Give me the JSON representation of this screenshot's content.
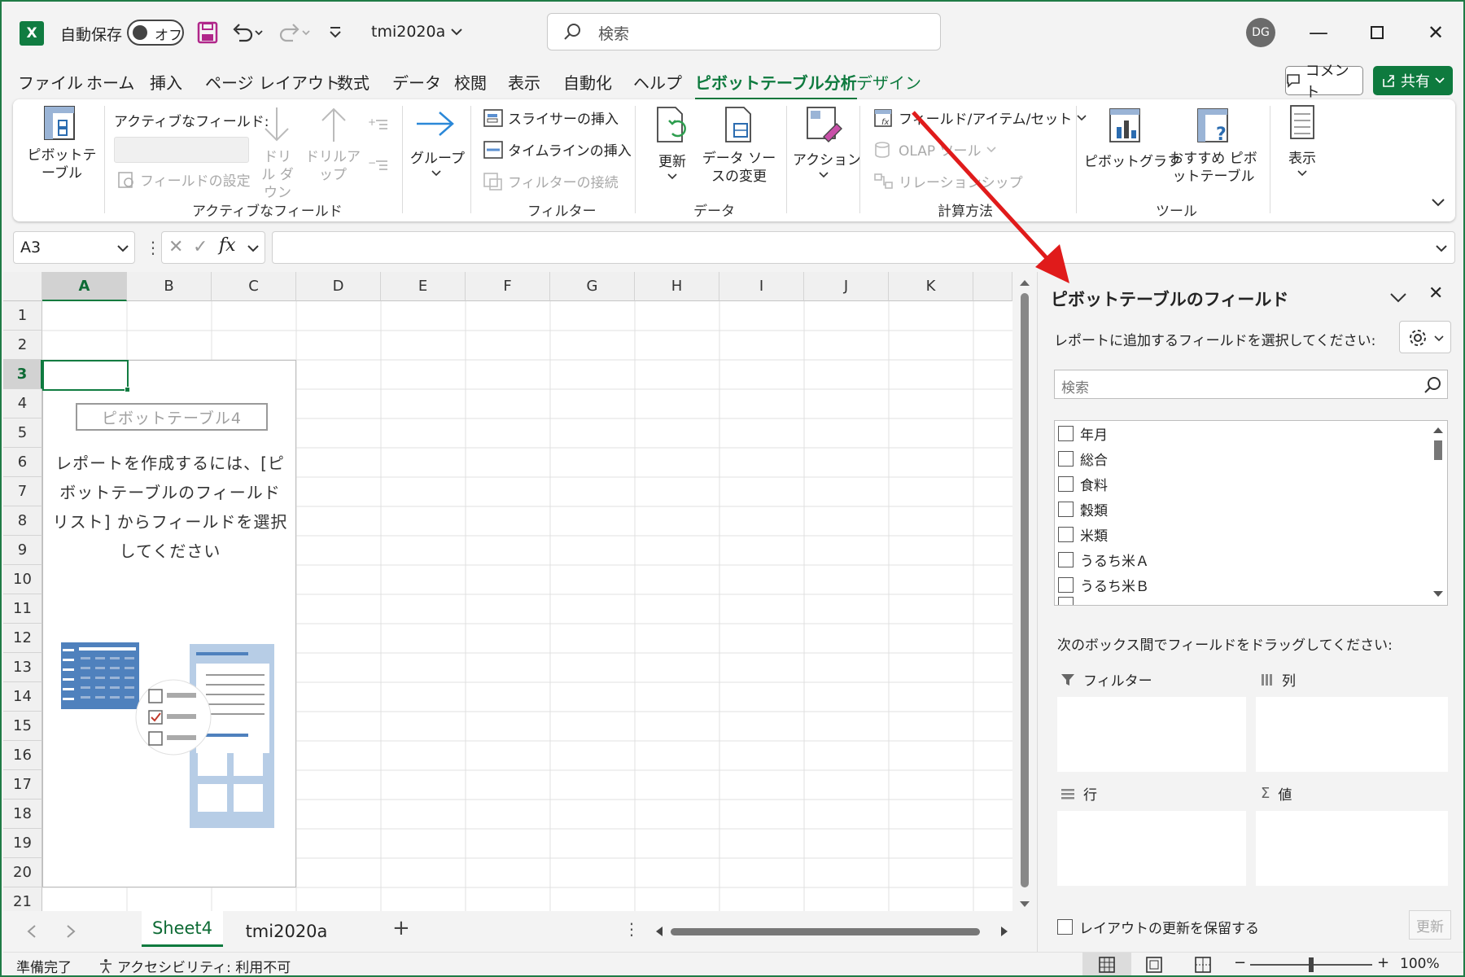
{
  "app": {
    "title": "tmi2020a",
    "autosave_label": "自動保存",
    "autosave_state": "オフ",
    "search_placeholder": "検索",
    "user_initials": "DG",
    "brand_color": "#107c41"
  },
  "menu": {
    "items": [
      "ファイル",
      "ホーム",
      "挿入",
      "ページ レイアウト",
      "数式",
      "データ",
      "校閲",
      "表示",
      "自動化",
      "ヘルプ",
      "ピボットテーブル分析",
      "デザイン"
    ],
    "active": "ピボットテーブル分析",
    "comment_label": "コメント",
    "share_label": "共有"
  },
  "ribbon": {
    "pivot_table_label": "ピボットテーブル",
    "active_field_label": "アクティブなフィールド:",
    "field_settings": "フィールドの設定",
    "drill_down": "ドリル ダウン",
    "drill_up": "ドリルアップ",
    "group_active_field": "アクティブなフィールド",
    "group_label": "グループ",
    "insert_slicer": "スライサーの挿入",
    "insert_timeline": "タイムラインの挿入",
    "filter_connections": "フィルターの接続",
    "group_filter": "フィルター",
    "refresh": "更新",
    "change_source": "データ ソースの変更",
    "group_data": "データ",
    "actions": "アクション",
    "fields_items_sets": "フィールド/アイテム/セット",
    "olap_tools": "OLAP ツール",
    "relationships": "リレーションシップ",
    "group_calc": "計算方法",
    "pivot_chart": "ピボットグラフ",
    "recommended_pivot": "おすすめ ピボットテーブル",
    "group_tools": "ツール",
    "show": "表示"
  },
  "formula_bar": {
    "name_box": "A3",
    "fx": "fx",
    "formula": ""
  },
  "grid": {
    "columns": [
      "A",
      "B",
      "C",
      "D",
      "E",
      "F",
      "G",
      "H",
      "I",
      "J",
      "K"
    ],
    "rows": [
      "1",
      "2",
      "3",
      "4",
      "5",
      "6",
      "7",
      "8",
      "9",
      "10",
      "11",
      "12",
      "13",
      "14",
      "15",
      "16",
      "17",
      "18",
      "19",
      "20",
      "21"
    ],
    "selected_cell": "A3"
  },
  "pivot_placeholder": {
    "name": "ピボットテーブル4",
    "instructions": "レポートを作成するには、[ピボットテーブルのフィールド リスト] からフィールドを選択してください"
  },
  "field_pane": {
    "title": "ピボットテーブルのフィールド",
    "instruction": "レポートに追加するフィールドを選択してください:",
    "search_placeholder": "検索",
    "fields": [
      "年月",
      "総合",
      "食料",
      "穀類",
      "米類",
      "うるち米Ａ",
      "うるち米Ｂ"
    ],
    "drag_instruction": "次のボックス間でフィールドをドラッグしてください:",
    "areas": {
      "filter": "フィルター",
      "columns": "列",
      "rows": "行",
      "values": "値"
    },
    "defer_label": "レイアウトの更新を保留する",
    "update_button": "更新"
  },
  "sheets": {
    "tabs": [
      "Sheet4",
      "tmi2020a"
    ],
    "active": "Sheet4"
  },
  "status": {
    "ready": "準備完了",
    "accessibility": "アクセシビリティ: 利用不可",
    "zoom": "100%"
  }
}
